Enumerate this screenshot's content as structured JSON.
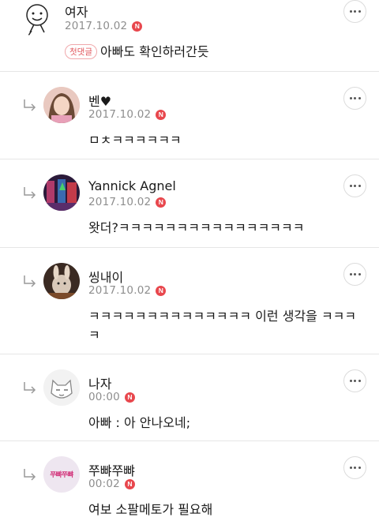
{
  "comments": [
    {
      "author": "여자",
      "date": "2017.10.02",
      "new_badge": "N",
      "first_badge": "첫댓글",
      "text": "아빠도 확인하러간듯",
      "avatar_icon": "smiley-avatar-icon"
    },
    {
      "author": "벤♥",
      "date": "2017.10.02",
      "new_badge": "N",
      "text": "ㅁㅊㅋㅋㅋㅋㅋㅋ",
      "avatar_icon": "photo-avatar-icon"
    },
    {
      "author": "Yannick Agnel",
      "date": "2017.10.02",
      "new_badge": "N",
      "text": "왓더?ㅋㅋㅋㅋㅋㅋㅋㅋㅋㅋㅋㅋㅋㅋㅋㅋ",
      "avatar_icon": "photo-avatar-icon"
    },
    {
      "author": "씽내이",
      "date": "2017.10.02",
      "new_badge": "N",
      "text_line1": "ㅋㅋㅋㅋㅋㅋㅋㅋㅋㅋㅋㅋㅋㅋ 이런 생각을 ㅋㅋㅋ",
      "text_line2": "ㅋ",
      "avatar_icon": "photo-avatar-icon"
    },
    {
      "author": "나자",
      "date": "00:00",
      "new_badge": "N",
      "text": "아빠 : 아 안나오네;",
      "avatar_icon": "cat-sketch-avatar-icon"
    },
    {
      "author": "쭈뺘쭈뺘",
      "date": "00:02",
      "new_badge": "N",
      "text": "여보 소팔메토가 필요해",
      "avatar_icon": "text-logo-avatar-icon",
      "avatar_text": "쭈뺘쭈뺘"
    }
  ],
  "icons": {
    "reply": "reply-arrow-icon",
    "more": "more-options-icon"
  }
}
